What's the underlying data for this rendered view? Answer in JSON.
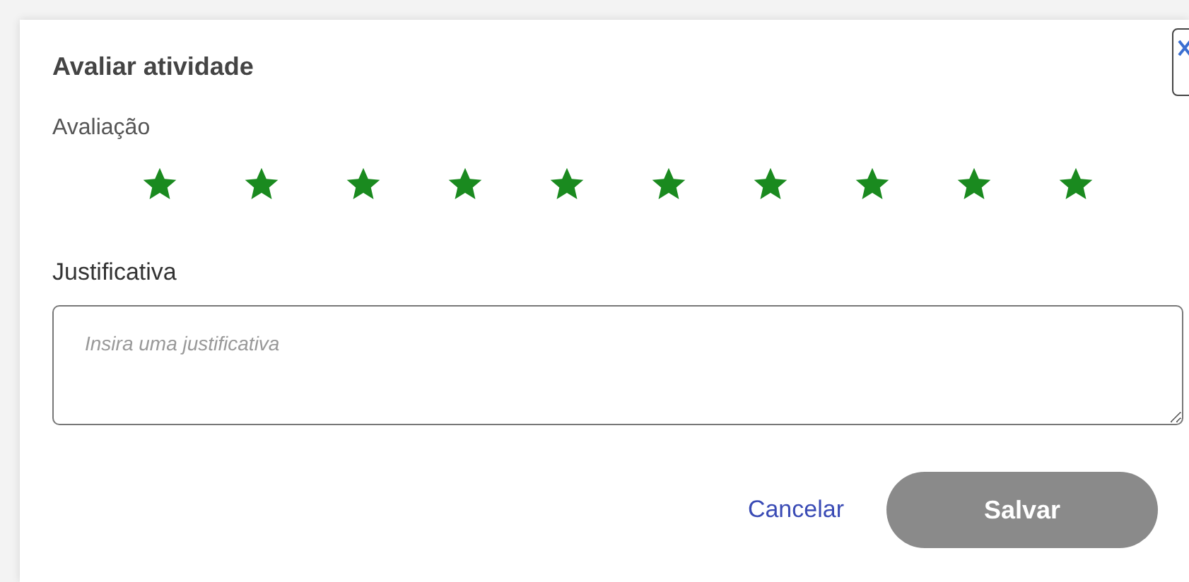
{
  "dialog": {
    "title": "Avaliar atividade"
  },
  "rating": {
    "label": "Avaliação",
    "stars": 10
  },
  "justification": {
    "label": "Justificativa",
    "placeholder": "Insira uma justificativa"
  },
  "buttons": [
    {
      "kind": "link",
      "label": "Cancelar",
      "disabled": false
    },
    {
      "kind": "primary",
      "label": "Salvar",
      "disabled": true
    }
  ]
}
